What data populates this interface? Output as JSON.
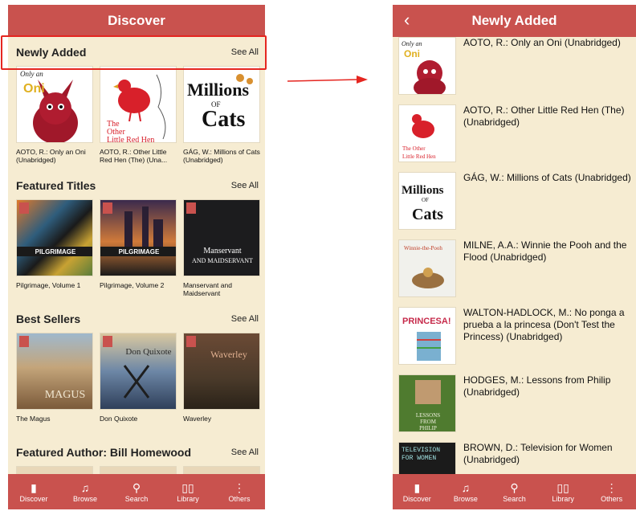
{
  "left": {
    "header_title": "Discover",
    "sections": [
      {
        "title": "Newly Added",
        "see_all": "See All",
        "books": [
          {
            "caption": "AOTO, R.: Only an Oni (Unabridged)",
            "cover_text": "Only an Oni"
          },
          {
            "caption": "AOTO, R.: Other Little Red Hen (The) (Una...",
            "cover_text": "The Other Little Red Hen"
          },
          {
            "caption": "GÁG, W.: Millions of Cats (Unabridged)",
            "cover_text": "Millions of Cats"
          }
        ]
      },
      {
        "title": "Featured Titles",
        "see_all": "See All",
        "books": [
          {
            "caption": "Pilgrimage, Volume 1",
            "cover_text": "PILGRIMAGE"
          },
          {
            "caption": "Pilgrimage, Volume 2",
            "cover_text": "PILGRIMAGE"
          },
          {
            "caption": "Manservant and Maidservant",
            "cover_text": "Manservant and Maidservant"
          }
        ]
      },
      {
        "title": "Best Sellers",
        "see_all": "See All",
        "books": [
          {
            "caption": "The Magus",
            "cover_text": "THE MAGUS"
          },
          {
            "caption": "Don Quixote",
            "cover_text": "Don Quixote"
          },
          {
            "caption": "Waverley",
            "cover_text": "Waverley"
          }
        ]
      },
      {
        "title": "Featured Author: Bill Homewood",
        "see_all": "See All",
        "books": []
      }
    ]
  },
  "right": {
    "header_title": "Newly Added",
    "back_icon": "‹",
    "items": [
      {
        "text": "AOTO, R.: Only an Oni (Unabridged)",
        "cover_text": "Only an Oni"
      },
      {
        "text": "AOTO, R.: Other Little Red Hen (The) (Unabridged)",
        "cover_text": "The Other Little Red Hen"
      },
      {
        "text": "GÁG, W.: Millions of Cats (Unabridged)",
        "cover_text": "Millions of Cats"
      },
      {
        "text": "MILNE, A.A.: Winnie the Pooh and the Flood (Unabridged)",
        "cover_text": "Winnie-the-Pooh"
      },
      {
        "text": "WALTON-HADLOCK, M.: No ponga a prueba a la princesa (Don't Test the Princess) (Unabridged)",
        "cover_text": "PRINCESA!"
      },
      {
        "text": "HODGES, M.: Lessons from Philip (Unabridged)",
        "cover_text": "LESSONS FROM PHILIP"
      },
      {
        "text": "BROWN, D.: Television for Women (Unabridged)",
        "cover_text": "TELEVISION FOR WOMEN"
      }
    ]
  },
  "tabs": [
    {
      "label": "Discover",
      "icon": "book-icon"
    },
    {
      "label": "Browse",
      "icon": "music-note-icon"
    },
    {
      "label": "Search",
      "icon": "search-icon"
    },
    {
      "label": "Library",
      "icon": "open-book-icon"
    },
    {
      "label": "Others",
      "icon": "more-vertical-icon"
    }
  ],
  "colors": {
    "header": "#c9524e",
    "background": "#f6ecd2",
    "highlight": "#e52620"
  }
}
